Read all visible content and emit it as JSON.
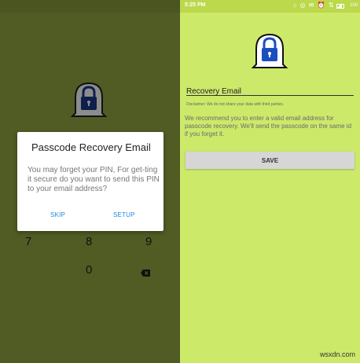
{
  "left_screen": {
    "lock_icon": "ghost-lock-icon",
    "dialog": {
      "title": "Passcode Recovery Email",
      "message": "You may forget your PIN, For get-ting it secure do you want to send this PIN to your email address?",
      "skip_label": "SKIP",
      "setup_label": "SETUP"
    },
    "keypad": {
      "keys": [
        "7",
        "8",
        "9",
        "0"
      ],
      "delete_icon": "backspace-icon"
    }
  },
  "right_screen": {
    "status_bar": {
      "time": "5:25 PM",
      "icons": "⌂ ◎ ✉ ⏰ ⇅ ◢",
      "battery": "100"
    },
    "lock_icon": "ghost-lock-icon",
    "email_field": {
      "value": "Recovery Email"
    },
    "disclaimer": "Disclaimer: We do not share your data with third parties.",
    "recommendation": "We recommend you to enter a valid email address for passcode recovery. We'll send the passcode on the same id if you forget it.",
    "save_label": "SAVE"
  },
  "watermark": "wsxdn.com",
  "colors": {
    "left_bg": "#505c24",
    "right_bg": "#cde96a",
    "accent_blue": "#1e88e5"
  }
}
